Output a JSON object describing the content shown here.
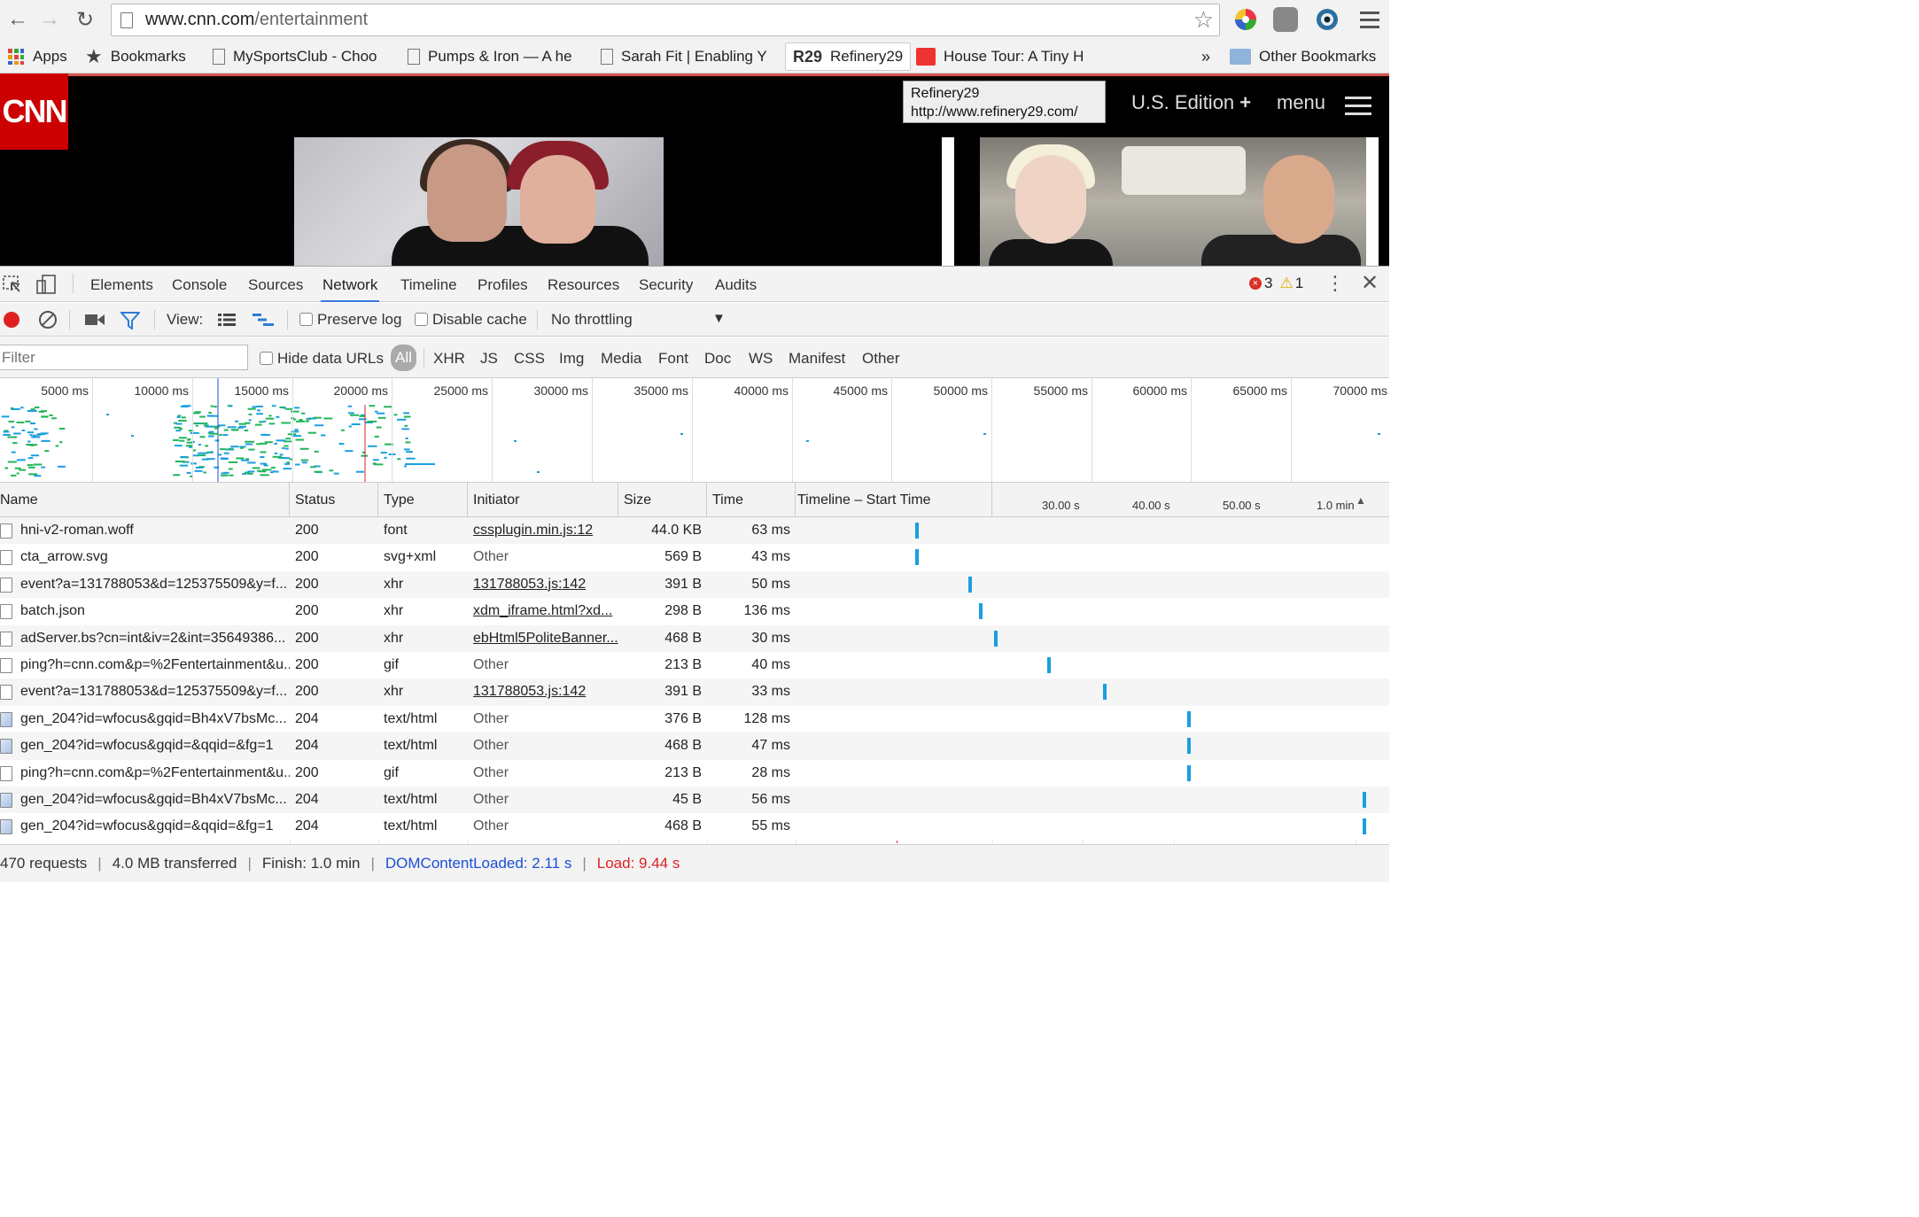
{
  "browser": {
    "url_host": "www.cnn.com",
    "url_path": "/entertainment",
    "bookmarks": [
      {
        "label": "Apps"
      },
      {
        "label": "Bookmarks"
      },
      {
        "label": "MySportsClub - Choo"
      },
      {
        "label": "Pumps & Iron — A he"
      },
      {
        "label": "Sarah Fit | Enabling Y"
      },
      {
        "label": "Refinery29"
      },
      {
        "label": "House Tour: A Tiny H"
      },
      {
        "label": "Other Bookmarks"
      }
    ],
    "overflow_label": "»"
  },
  "page": {
    "logo": "CNN",
    "edition_label": "U.S. Edition",
    "edition_plus": "+",
    "menu_label": "menu",
    "tooltip_title": "Refinery29",
    "tooltip_url": "http://www.refinery29.com/"
  },
  "devtools": {
    "tabs": [
      "Elements",
      "Console",
      "Sources",
      "Network",
      "Timeline",
      "Profiles",
      "Resources",
      "Security",
      "Audits"
    ],
    "active_tab": "Network",
    "error_count": "3",
    "warning_count": "1",
    "toolbar": {
      "view_label": "View:",
      "preserve_log": "Preserve log",
      "disable_cache": "Disable cache",
      "throttling": "No throttling"
    },
    "filter": {
      "placeholder": "Filter",
      "hide_data_urls": "Hide data URLs",
      "types": [
        "All",
        "XHR",
        "JS",
        "CSS",
        "Img",
        "Media",
        "Font",
        "Doc",
        "WS",
        "Manifest",
        "Other"
      ]
    },
    "overview_ticks": [
      "5000 ms",
      "10000 ms",
      "15000 ms",
      "20000 ms",
      "25000 ms",
      "30000 ms",
      "35000 ms",
      "40000 ms",
      "45000 ms",
      "50000 ms",
      "55000 ms",
      "60000 ms",
      "65000 ms",
      "70000 ms"
    ],
    "columns": [
      "Name",
      "Status",
      "Type",
      "Initiator",
      "Size",
      "Time",
      "Timeline – Start Time"
    ],
    "timeline_scale": [
      "30.00 s",
      "40.00 s",
      "50.00 s",
      "1.0 min"
    ],
    "rows": [
      {
        "name": "hni-v2-roman.woff",
        "status": "200",
        "type": "font",
        "initiator": "cssplugin.min.js:12",
        "size": "44.0 KB",
        "time": "63 ms",
        "start": 0.205,
        "icon": "doc",
        "link": true
      },
      {
        "name": "cta_arrow.svg",
        "status": "200",
        "type": "svg+xml",
        "initiator": "Other",
        "size": "569 B",
        "time": "43 ms",
        "start": 0.205,
        "icon": "doc",
        "link": false
      },
      {
        "name": "event?a=131788053&d=125375509&y=f...",
        "status": "200",
        "type": "xhr",
        "initiator": "131788053.js:142",
        "size": "391 B",
        "time": "50 ms",
        "start": 0.295,
        "icon": "doc",
        "link": true
      },
      {
        "name": "batch.json",
        "status": "200",
        "type": "xhr",
        "initiator": "xdm_iframe.html?xd...",
        "size": "298 B",
        "time": "136 ms",
        "start": 0.313,
        "icon": "doc",
        "link": true
      },
      {
        "name": "adServer.bs?cn=int&iv=2&int=35649386...",
        "status": "200",
        "type": "xhr",
        "initiator": "ebHtml5PoliteBanner...",
        "size": "468 B",
        "time": "30 ms",
        "start": 0.34,
        "icon": "doc",
        "link": true
      },
      {
        "name": "ping?h=cnn.com&p=%2Fentertainment&u...",
        "status": "200",
        "type": "gif",
        "initiator": "Other",
        "size": "213 B",
        "time": "40 ms",
        "start": 0.43,
        "icon": "doc",
        "link": false
      },
      {
        "name": "event?a=131788053&d=125375509&y=f...",
        "status": "200",
        "type": "xhr",
        "initiator": "131788053.js:142",
        "size": "391 B",
        "time": "33 ms",
        "start": 0.525,
        "icon": "doc",
        "link": true
      },
      {
        "name": "gen_204?id=wfocus&gqid=Bh4xV7bsMc...",
        "status": "204",
        "type": "text/html",
        "initiator": "Other",
        "size": "376 B",
        "time": "128 ms",
        "start": 0.67,
        "icon": "img",
        "link": false
      },
      {
        "name": "gen_204?id=wfocus&gqid=&qqid=&fg=1",
        "status": "204",
        "type": "text/html",
        "initiator": "Other",
        "size": "468 B",
        "time": "47 ms",
        "start": 0.67,
        "icon": "img",
        "link": false
      },
      {
        "name": "ping?h=cnn.com&p=%2Fentertainment&u...",
        "status": "200",
        "type": "gif",
        "initiator": "Other",
        "size": "213 B",
        "time": "28 ms",
        "start": 0.67,
        "icon": "doc",
        "link": false
      },
      {
        "name": "gen_204?id=wfocus&gqid=Bh4xV7bsMc...",
        "status": "204",
        "type": "text/html",
        "initiator": "Other",
        "size": "45 B",
        "time": "56 ms",
        "start": 0.97,
        "icon": "img",
        "link": false
      },
      {
        "name": "gen_204?id=wfocus&gqid=&qqid=&fg=1",
        "status": "204",
        "type": "text/html",
        "initiator": "Other",
        "size": "468 B",
        "time": "55 ms",
        "start": 0.97,
        "icon": "img",
        "link": false
      }
    ],
    "status": {
      "requests": "470 requests",
      "transferred": "4.0 MB transferred",
      "finish": "Finish: 1.0 min",
      "dom_content_loaded": "DOMContentLoaded: 2.11 s",
      "load": "Load: 9.44 s"
    }
  },
  "colors": {
    "accent": "#3879d9",
    "bar": "#1a9fe0",
    "cnn_red": "#cc0000",
    "load_red": "#dd2222",
    "dcl_blue": "#1a4fd6"
  }
}
